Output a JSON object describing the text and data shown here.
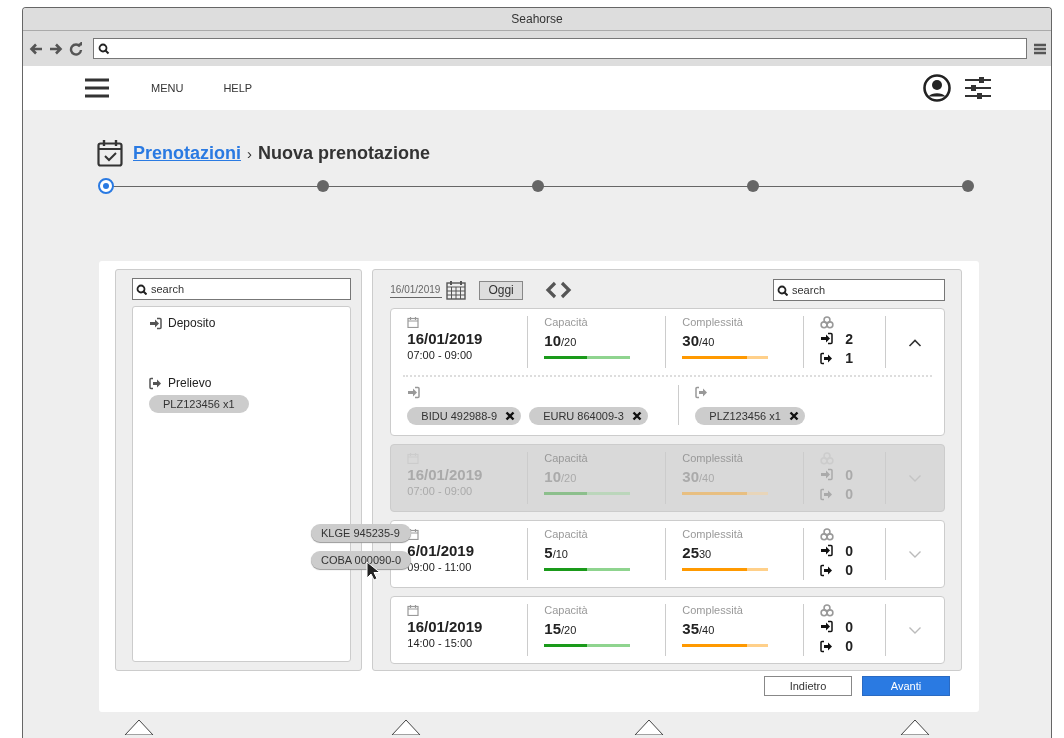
{
  "window": {
    "title": "Seahorse"
  },
  "nav": {
    "items": [
      "MENU",
      "HELP"
    ]
  },
  "breadcrumb": {
    "link": "Prenotazioni",
    "separator": "›",
    "current": "Nuova prenotazione"
  },
  "stepper": [
    {
      "selected": true
    },
    {
      "selected": false
    },
    {
      "selected": false
    },
    {
      "selected": false
    },
    {
      "selected": false
    }
  ],
  "left_panel": {
    "search": {
      "placeholder": "search"
    },
    "groups": [
      {
        "kind": "deposit",
        "label": "Deposito"
      },
      {
        "kind": "pickup",
        "label": "Prelievo",
        "chips": [
          "PLZ123456 x1"
        ]
      }
    ]
  },
  "schedule": {
    "date": "16/01/2019",
    "today_button": "Oggi",
    "search": {
      "placeholder": "search"
    },
    "cards": [
      {
        "date": "16/01/2019",
        "time": "07:00 - 09:00",
        "capacity": {
          "label": "Capacità",
          "value": "10",
          "max": "/20",
          "level": 0.5
        },
        "complexity": {
          "label": "Complessità",
          "value": "30",
          "max": "/40",
          "level": 0.75
        },
        "in_count": "2",
        "out_count": "1",
        "expanded": true,
        "disabled": false,
        "deposits": [
          "BIDU 492988-9",
          "EURU 864009-3"
        ],
        "pickups": [
          "PLZ123456 x1"
        ]
      },
      {
        "date": "16/01/2019",
        "time": "07:00 - 09:00",
        "capacity": {
          "label": "Capacità",
          "value": "10",
          "max": "/20",
          "level": 0.5
        },
        "complexity": {
          "label": "Complessità",
          "value": "30",
          "max": "/40",
          "level": 0.75
        },
        "in_count": "0",
        "out_count": "0",
        "expanded": false,
        "disabled": true
      },
      {
        "date": "6/01/2019",
        "time": "09:00 - 11:00",
        "capacity": {
          "label": "Capacità",
          "value": "5",
          "max": "/10",
          "level": 0.5
        },
        "complexity": {
          "label": "Complessità",
          "value": "25",
          "max": "30",
          "level": 0.75
        },
        "in_count": "0",
        "out_count": "0",
        "expanded": false,
        "disabled": false
      },
      {
        "date": "16/01/2019",
        "time": "14:00 - 15:00",
        "capacity": {
          "label": "Capacità",
          "value": "15",
          "max": "/20",
          "level": 0.5
        },
        "complexity": {
          "label": "Complessità",
          "value": "35",
          "max": "/40",
          "level": 0.75
        },
        "in_count": "0",
        "out_count": "0",
        "expanded": false,
        "disabled": false
      }
    ]
  },
  "dragged_chips": [
    "KLGE 945235-9",
    "COBA 000090-0"
  ],
  "buttons": [
    {
      "label": "Indietro",
      "kind": "secondary"
    },
    {
      "label": "Avanti",
      "kind": "primary"
    }
  ]
}
